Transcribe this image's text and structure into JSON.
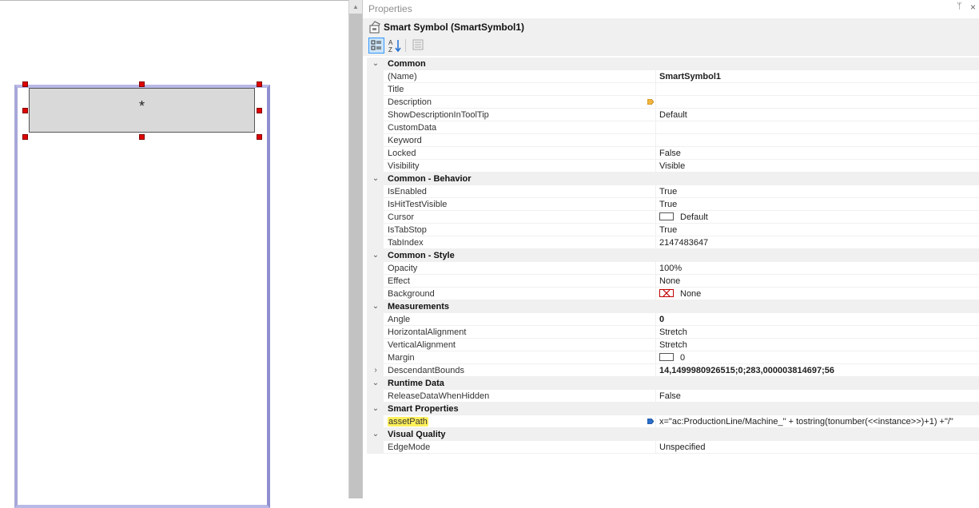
{
  "panel": {
    "title": "Properties",
    "pin_glyph": "ᛘ",
    "close_glyph": "×",
    "object_name": "Smart  Symbol  (SmartSymbol1)"
  },
  "canvas": {
    "symbol_text": "*"
  },
  "categories": [
    {
      "label": "Common",
      "expanded": true,
      "props": [
        {
          "name": "(Name)",
          "value": "SmartSymbol1",
          "bold": true
        },
        {
          "name": "Title",
          "value": ""
        },
        {
          "name": "Description",
          "value": "",
          "marker": "orange"
        },
        {
          "name": "ShowDescriptionInToolTip",
          "value": "Default"
        },
        {
          "name": "CustomData",
          "value": ""
        },
        {
          "name": "Keyword",
          "value": ""
        },
        {
          "name": "Locked",
          "value": "False"
        },
        {
          "name": "Visibility",
          "value": "Visible"
        }
      ]
    },
    {
      "label": "Common - Behavior",
      "expanded": true,
      "props": [
        {
          "name": "IsEnabled",
          "value": "True"
        },
        {
          "name": "IsHitTestVisible",
          "value": "True"
        },
        {
          "name": "Cursor",
          "value": "Default",
          "swatch": "plain"
        },
        {
          "name": "IsTabStop",
          "value": "True"
        },
        {
          "name": "TabIndex",
          "value": "2147483647"
        }
      ]
    },
    {
      "label": "Common - Style",
      "expanded": true,
      "props": [
        {
          "name": "Opacity",
          "value": "100%"
        },
        {
          "name": "Effect",
          "value": "None"
        },
        {
          "name": "Background",
          "value": "None",
          "swatch": "x"
        }
      ]
    },
    {
      "label": "Measurements",
      "expanded": true,
      "props": [
        {
          "name": "Angle",
          "value": "0",
          "bold": true
        },
        {
          "name": "HorizontalAlignment",
          "value": "Stretch"
        },
        {
          "name": "VerticalAlignment",
          "value": "Stretch"
        },
        {
          "name": "Margin",
          "value": "0",
          "swatch": "plain"
        },
        {
          "name": "DescendantBounds",
          "value": "14,1499980926515;0;283,000003814697;56",
          "bold": true,
          "collapsible": true
        }
      ]
    },
    {
      "label": "Runtime Data",
      "expanded": true,
      "props": [
        {
          "name": "ReleaseDataWhenHidden",
          "value": "False"
        }
      ]
    },
    {
      "label": "Smart Properties",
      "expanded": true,
      "props": [
        {
          "name": "assetPath",
          "value": "x=\"ac:ProductionLine/Machine_\" + tostring(tonumber(<<instance>>)+1) +\"/\"",
          "marker": "blue",
          "highlight": true
        }
      ]
    },
    {
      "label": "Visual Quality",
      "expanded": true,
      "props": [
        {
          "name": "EdgeMode",
          "value": "Unspecified"
        }
      ]
    }
  ],
  "colors": {
    "selection_handle": "#e00000",
    "symbol_border": "#b9b9e6",
    "category_bg": "#f0f0f0",
    "highlight": "#fff05a"
  }
}
